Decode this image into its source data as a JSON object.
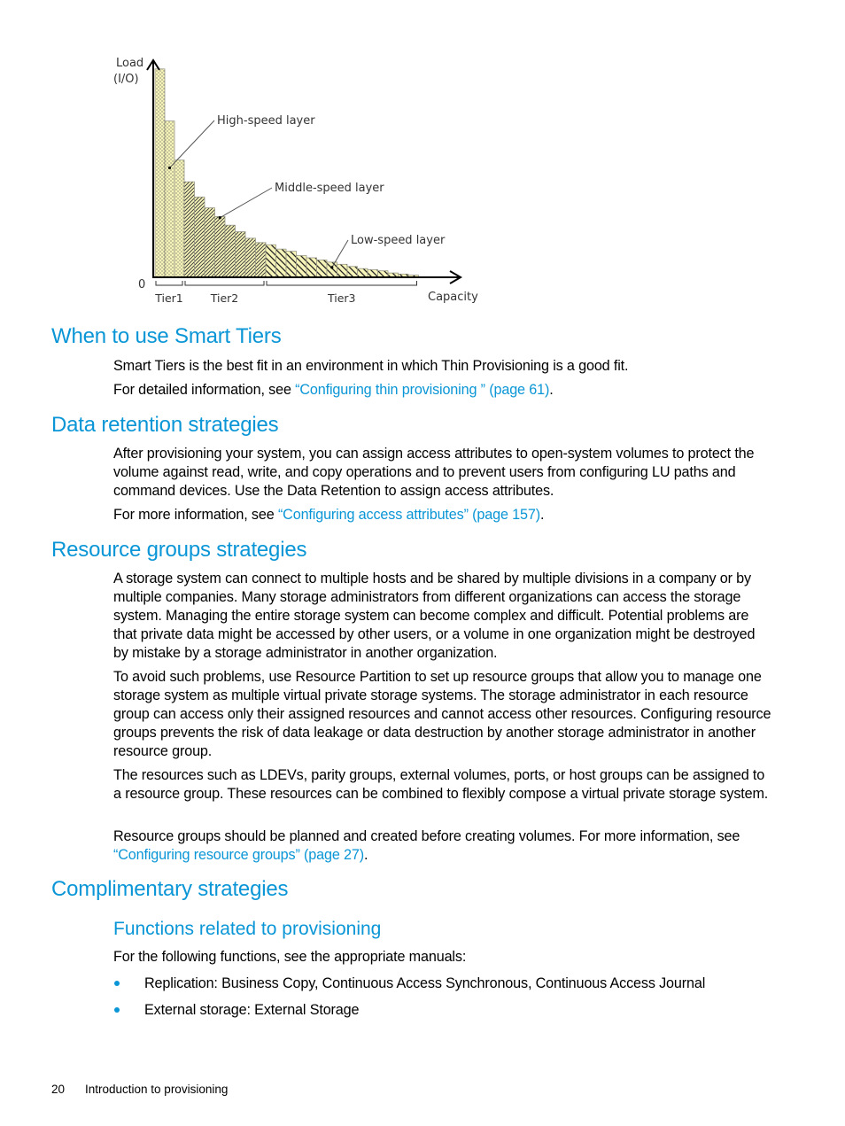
{
  "chart_data": {
    "type": "bar",
    "title": "",
    "xlabel": "Capacity",
    "ylabel": "Load (I/O)",
    "ylabel_lines": [
      "Load",
      "(I/O)"
    ],
    "origin_label": "0",
    "ylim": [
      0,
      100
    ],
    "grid": false,
    "tiers": [
      {
        "name": "Tier1",
        "layer": "High-speed layer",
        "pattern": "dots",
        "values": [
          96,
          72,
          54
        ]
      },
      {
        "name": "Tier2",
        "layer": "Middle-speed layer",
        "pattern": "fine-hatch",
        "values": [
          44,
          37,
          32,
          28,
          24,
          21,
          18,
          16
        ]
      },
      {
        "name": "Tier3",
        "layer": "Low-speed layer",
        "pattern": "wide-hatch",
        "values": [
          15,
          13,
          12,
          10,
          9,
          8,
          7,
          6,
          5,
          4,
          3.5,
          3,
          2,
          1.5,
          1
        ]
      }
    ],
    "annotations": [
      "High-speed layer",
      "Middle-speed layer",
      "Low-speed layer"
    ],
    "bar_fill": "#f5f3b8",
    "bar_stroke": "#9a9a88"
  },
  "sections": {
    "smart_tiers": {
      "heading": "When to use Smart Tiers",
      "p1": "Smart Tiers is the best fit in an environment in which Thin Provisioning is a good fit.",
      "p2_prefix": "For detailed information, see ",
      "p2_link": "“Configuring thin provisioning ” (page 61)",
      "p2_suffix": "."
    },
    "data_retention": {
      "heading": "Data retention strategies",
      "p1": "After provisioning your system, you can assign access attributes to open-system volumes to protect the volume against read, write, and copy operations and to prevent users from configuring LU paths and command devices. Use the Data Retention to assign access attributes.",
      "p2_prefix": "For more information, see ",
      "p2_link": "“Configuring access attributes” (page 157)",
      "p2_suffix": "."
    },
    "resource_groups": {
      "heading": "Resource groups strategies",
      "p1": "A storage system can connect to multiple hosts and be shared by multiple divisions in a company or by multiple companies. Many storage administrators from different organizations can access the storage system. Managing the entire storage system can become complex and difficult. Potential problems are that private data might be accessed by other users, or a volume in one organization might be destroyed by mistake by a storage administrator in another organization.",
      "p2": "To avoid such problems, use Resource Partition to set up resource groups that allow you to manage one storage system as multiple virtual private storage systems. The storage administrator in each resource group can access only their assigned resources and cannot access other resources. Configuring resource groups prevents the risk of data leakage or data destruction by another storage administrator in another resource group.",
      "p3": "The resources such as LDEVs, parity groups, external volumes, ports, or host groups can be assigned to a resource group. These resources can be combined to flexibly compose a virtual private storage system.",
      "p4_prefix": "Resource groups should be planned and created before creating volumes. For more information, see ",
      "p4_link": "“Configuring resource groups” (page 27)",
      "p4_suffix": "."
    },
    "complimentary": {
      "heading": "Complimentary strategies",
      "subheading": "Functions related to provisioning",
      "intro": "For the following functions, see the appropriate manuals:",
      "bullets": [
        "Replication: Business Copy, Continuous Access Synchronous, Continuous Access Journal",
        "External storage: External Storage"
      ]
    }
  },
  "footer": {
    "page_number": "20",
    "chapter_title": "Introduction to provisioning"
  }
}
